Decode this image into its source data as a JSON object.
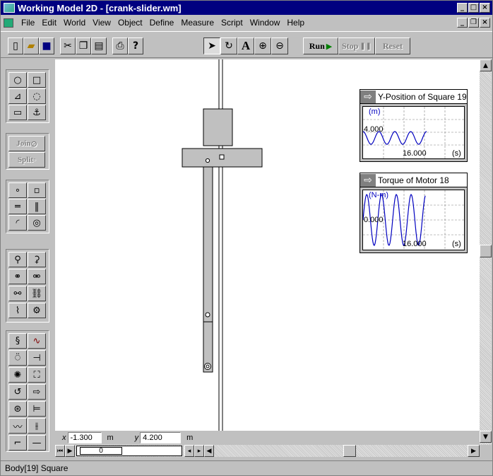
{
  "window": {
    "title": "Working Model 2D - [crank-slider.wm]",
    "caption_buttons": [
      "_",
      "□",
      "×"
    ],
    "mdi_buttons": [
      "_",
      "❐",
      "×"
    ]
  },
  "menu": [
    "File",
    "Edit",
    "World",
    "View",
    "Object",
    "Define",
    "Measure",
    "Script",
    "Window",
    "Help"
  ],
  "toolbar": {
    "run_label": "Run",
    "stop_label": "Stop",
    "reset_label": "Reset",
    "text_tool": "A"
  },
  "palette": {
    "join_label": "Join",
    "split_label": "Split"
  },
  "coords": {
    "x_label": "x",
    "x_value": "-1.300",
    "x_unit": "m",
    "y_label": "y",
    "y_value": "4.200",
    "y_unit": "m"
  },
  "hscroll": {
    "frame": "0"
  },
  "status": {
    "text": "Body[19] Square"
  },
  "meters": [
    {
      "title": "Y-Position of Square 19",
      "unit": "(m)",
      "y_label": "4.000",
      "x_label": "16.000",
      "x_unit": "(s)",
      "line_color": "#0000c0"
    },
    {
      "title": "Torque of Motor 18",
      "unit": "(N-m)",
      "y_label": "0.000",
      "x_label": "16.000",
      "x_unit": "(s)",
      "line_color": "#0000c0"
    }
  ],
  "colors": {
    "title_bar": "#000080",
    "body_fill": "#c0c0c0",
    "meter_line": "#0000c0"
  }
}
